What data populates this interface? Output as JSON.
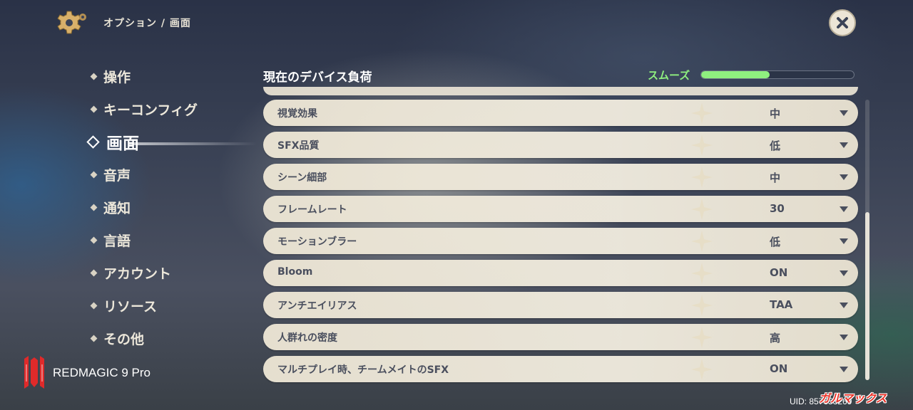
{
  "header": {
    "breadcrumb": "オプション / 画面"
  },
  "sidebar": {
    "items": [
      {
        "label": "操作"
      },
      {
        "label": "キーコンフィグ"
      },
      {
        "label": "画面"
      },
      {
        "label": "音声"
      },
      {
        "label": "通知"
      },
      {
        "label": "言語"
      },
      {
        "label": "アカウント"
      },
      {
        "label": "リソース"
      },
      {
        "label": "その他"
      }
    ],
    "active_index": 2
  },
  "device_load": {
    "title": "現在のデバイス負荷",
    "status": "スムーズ",
    "level": 0.45,
    "color": "#8ff07f"
  },
  "settings": [
    {
      "label": "視覚効果",
      "value": "中"
    },
    {
      "label": "SFX品質",
      "value": "低"
    },
    {
      "label": "シーン細部",
      "value": "中"
    },
    {
      "label": "フレームレート",
      "value": "30"
    },
    {
      "label": "モーションブラー",
      "value": "低"
    },
    {
      "label": "Bloom",
      "value": "ON"
    },
    {
      "label": "アンチエイリアス",
      "value": "TAA"
    },
    {
      "label": "人群れの密度",
      "value": "高"
    },
    {
      "label": "マルチプレイ時、チームメイトのSFX",
      "value": "ON"
    }
  ],
  "device_brand": "REDMAGIC 9 Pro",
  "uid": "UID: 857653269",
  "watermark": "ガルマックス",
  "icons": {
    "settings": "gear-icon",
    "close": "close-icon",
    "dropdown": "caret-down-icon",
    "brand": "redmagic-logo-icon"
  }
}
